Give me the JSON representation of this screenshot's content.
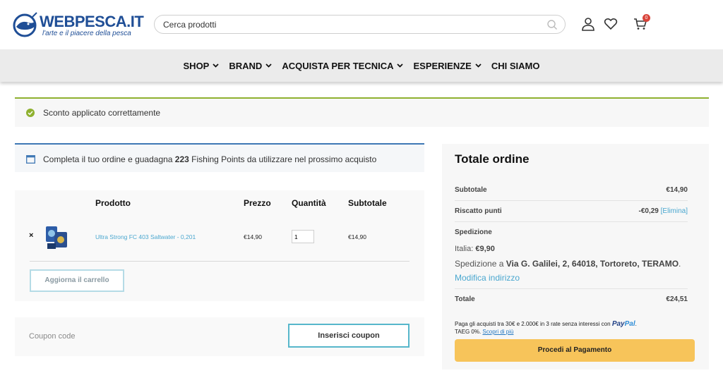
{
  "header": {
    "logo_text": "WEBPESCA.IT",
    "logo_tagline": "l'arte e il piacere della pesca",
    "search_placeholder": "Cerca prodotti",
    "cart_count": "0"
  },
  "nav": {
    "items": [
      {
        "label": "SHOP",
        "has_dropdown": true
      },
      {
        "label": "BRAND",
        "has_dropdown": true
      },
      {
        "label": "ACQUISTA PER TECNICA",
        "has_dropdown": true
      },
      {
        "label": "ESPERIENZE",
        "has_dropdown": true
      },
      {
        "label": "CHI SIAMO",
        "has_dropdown": false
      }
    ]
  },
  "notice": {
    "message": "Sconto applicato correttamente",
    "color": "#8fb130"
  },
  "points": {
    "before": "Completa il tuo ordine e guadagna ",
    "amount": "223",
    "after": " Fishing Points da utilizzare nel prossimo acquisto"
  },
  "cart": {
    "headers": {
      "product": "Prodotto",
      "price": "Prezzo",
      "quantity": "Quantità",
      "subtotal": "Subtotale"
    },
    "items": [
      {
        "remove": "×",
        "name": "Ultra Strong FC 403 Saltwater - 0,201",
        "price": "€14,90",
        "quantity": "1",
        "subtotal": "€14,90"
      }
    ],
    "update_label": "Aggiorna il carrello"
  },
  "coupon": {
    "placeholder": "Coupon code",
    "button_label": "Inserisci coupon"
  },
  "totals": {
    "title": "Totale ordine",
    "subtotal_label": "Subtotale",
    "subtotal_value": "€14,90",
    "points_label": "Riscatto punti",
    "points_value": "-€0,29",
    "points_remove": "[Elimina]",
    "shipping_label": "Spedizione",
    "shipping_method_prefix": "Italia: ",
    "shipping_method_value": "€9,90",
    "shipping_address_prefix": "Spedizione a ",
    "shipping_address": "Via G. Galilei, 2, 64018, Tortoreto, TERAMO",
    "shipping_address_suffix": ".",
    "modify_address": "Modifica indirizzo",
    "total_label": "Totale",
    "total_value": "€24,51",
    "paypal_text": "Paga gli acquisti tra 30€ e 2.000€ in 3 rate senza interessi con ",
    "paypal_logo_a": "Pay",
    "paypal_logo_b": "Pal",
    "paypal_logo_suffix": ".",
    "paypal_taeg": "TAEG 0%. ",
    "paypal_more": "Scopri di più",
    "checkout_label": "Procedi al Pagamento"
  },
  "colors": {
    "brand": "#1f4e96",
    "link": "#4aa7cf",
    "checkout": "#f7c45a",
    "points_border": "#3f78b5"
  }
}
